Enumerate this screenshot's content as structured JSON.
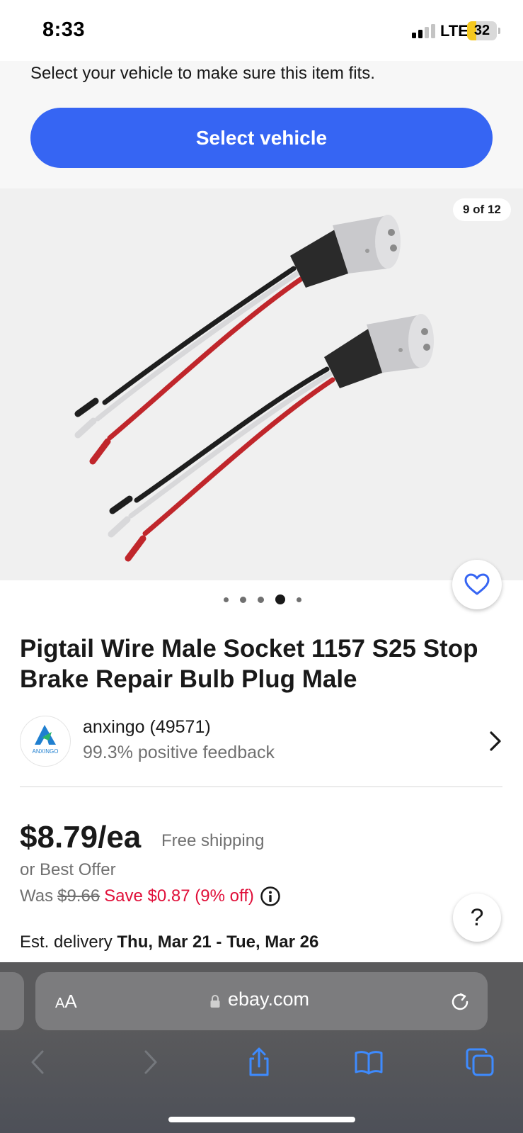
{
  "status_bar": {
    "time": "8:33",
    "network": "LTE",
    "battery": "32",
    "battery_level": 0.32,
    "signal_bars_active": 2,
    "signal_bars_total": 4
  },
  "vehicle": {
    "prompt": "Select your vehicle to make sure this item fits.",
    "button_label": "Select vehicle"
  },
  "gallery": {
    "counter": "9 of 12",
    "image_icon": "product-photo-icon",
    "dots_total": 5,
    "active_dot": 4
  },
  "product": {
    "title": "Pigtail Wire Male Socket 1157 S25 Stop Brake Repair Bulb Plug Male"
  },
  "seller": {
    "name": "anxingo (49571)",
    "feedback": "99.3% positive feedback",
    "logo_text": "ANXINGO"
  },
  "pricing": {
    "price": "$8.79/ea",
    "shipping": "Free shipping",
    "best_offer": "or Best Offer",
    "was_label": "Was",
    "was_price": "$9.66",
    "savings": "Save $0.87 (9% off)"
  },
  "delivery": {
    "label": "Est. delivery",
    "dates": "Thu, Mar 21 - Tue, Mar 26"
  },
  "help": {
    "label": "?"
  },
  "browser": {
    "aa_small": "A",
    "aa_large": "A",
    "url": "ebay.com"
  },
  "colors": {
    "accent": "#3665f3",
    "savings": "#e0103a",
    "secondary_text": "#707070"
  }
}
